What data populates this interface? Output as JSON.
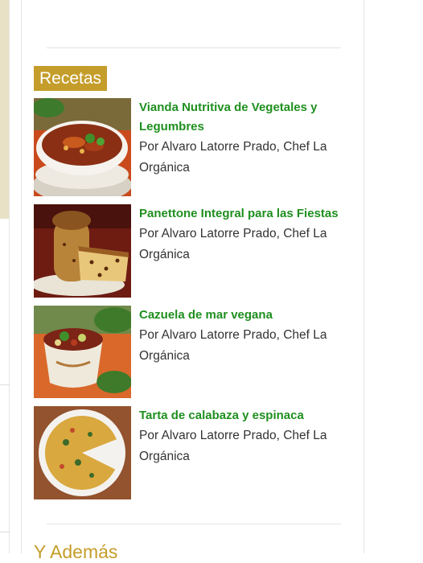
{
  "recetas": {
    "header": "Recetas",
    "items": [
      {
        "title": "Vianda Nutritiva de Vegetales y Legumbres",
        "author": "Por Alvaro Latorre Prado, Chef La Orgánica",
        "image_icon": "soup-bowl-photo"
      },
      {
        "title": "Panettone Integral para las Fiestas",
        "author": "Por Alvaro Latorre Prado, Chef La Orgánica",
        "image_icon": "panettone-photo"
      },
      {
        "title": "Cazuela de mar vegana",
        "author": "Por Alvaro Latorre Prado, Chef La Orgánica",
        "image_icon": "cazuela-photo"
      },
      {
        "title": "Tarta de calabaza y espinaca",
        "author": "Por Alvaro Latorre Prado, Chef La Orgánica",
        "image_icon": "tart-photo"
      }
    ]
  },
  "next_section": {
    "heading": "Y Además"
  },
  "colors": {
    "accent": "#c59d2a",
    "title_green": "#1f8f1f",
    "text": "#333333"
  }
}
